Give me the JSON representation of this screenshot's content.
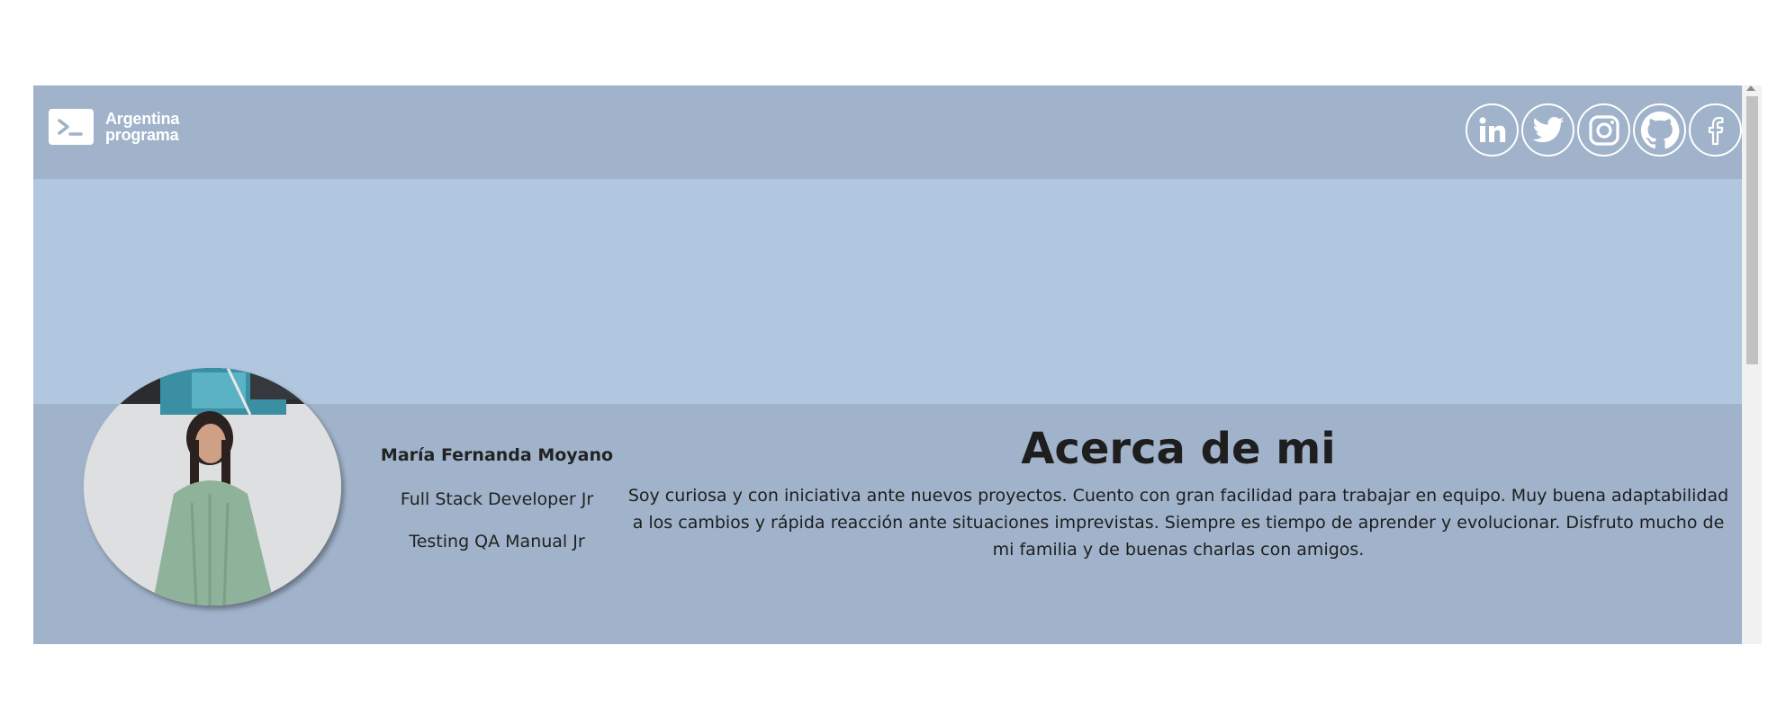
{
  "brand": {
    "line1": "Argentina",
    "line2": "programa",
    "icon": "terminal-icon"
  },
  "socials": [
    {
      "name": "linkedin",
      "icon": "linkedin-icon"
    },
    {
      "name": "twitter",
      "icon": "twitter-icon"
    },
    {
      "name": "instagram",
      "icon": "instagram-icon"
    },
    {
      "name": "github",
      "icon": "github-icon"
    },
    {
      "name": "facebook",
      "icon": "facebook-icon"
    }
  ],
  "profile": {
    "name": "María Fernanda Moyano",
    "roles": [
      "Full Stack Developer Jr",
      "Testing QA Manual Jr"
    ]
  },
  "about": {
    "title": "Acerca de mi",
    "text": "Soy curiosa y con iniciativa ante nuevos proyectos. Cuento con gran facilidad para trabajar en equipo. Muy buena adaptabilidad a los cambios y rápida reacción ante situaciones imprevistas. Siempre es tiempo de aprender y evolucionar. Disfruto mucho de mi familia y de buenas charlas con amigos."
  },
  "colors": {
    "navbar": "#a0b3ca",
    "banner": "#b1c7df",
    "text": "#1e1e1e"
  }
}
